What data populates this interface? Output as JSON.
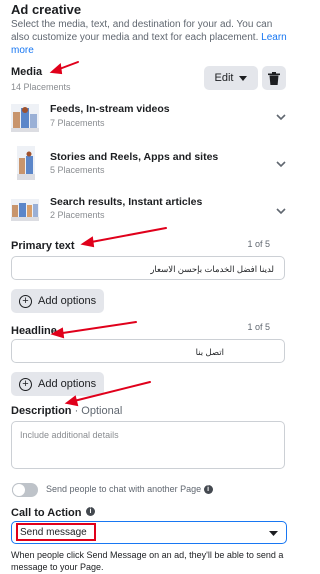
{
  "header": {
    "title": "Ad creative",
    "intro": "Select the media, text, and destination for your ad. You can also customize your media and text for each placement.",
    "learn_more": "Learn more"
  },
  "media": {
    "title": "Media",
    "count": "14 Placements",
    "edit_label": "Edit",
    "items": [
      {
        "title": "Feeds, In-stream videos",
        "sub": "7 Placements"
      },
      {
        "title": "Stories and Reels, Apps and sites",
        "sub": "5 Placements"
      },
      {
        "title": "Search results, Instant articles",
        "sub": "2 Placements"
      }
    ]
  },
  "primary_text": {
    "label": "Primary text",
    "counter": "1 of 5",
    "value": "لدينا افضل الخدمات بإحسن الاسعار",
    "add_label": "Add options"
  },
  "headline": {
    "label": "Headline",
    "counter": "1 of 5",
    "value": "اتصل بنا",
    "add_label": "Add options"
  },
  "description": {
    "label": "Description",
    "optional": " · Optional",
    "placeholder": "Include additional details"
  },
  "chat_toggle": {
    "label": "Send people to chat with another Page"
  },
  "cta": {
    "label": "Call to Action",
    "value": "Send message",
    "help": "When people click Send Message on an ad, they'll be able to send a message to your Page."
  },
  "colors": {
    "accent": "#1877f2",
    "annotation_red": "#e0001b"
  }
}
